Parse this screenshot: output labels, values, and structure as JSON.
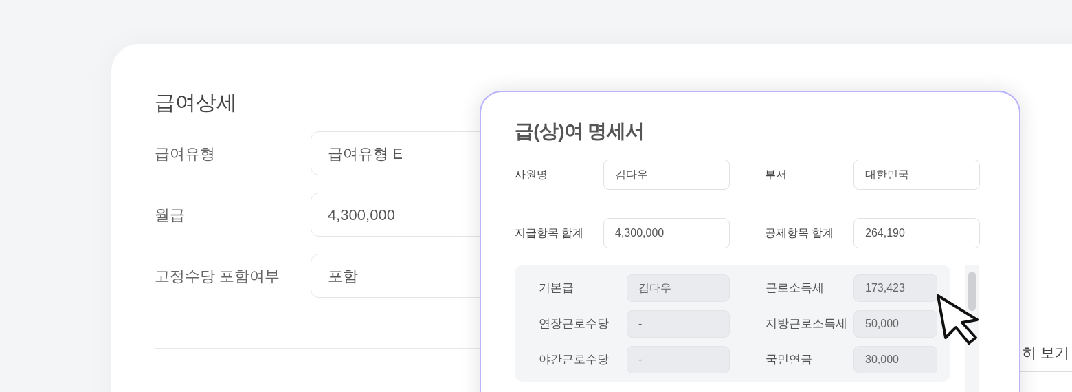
{
  "detail_card": {
    "title": "급여상세",
    "fields": [
      {
        "label": "급여유형",
        "value": "급여유형 E"
      },
      {
        "label": "월급",
        "value": "4,300,000"
      },
      {
        "label": "고정수당 포함여부",
        "value": "포함"
      }
    ],
    "button": "히 보기"
  },
  "payslip": {
    "title": "급(상)여 명세서",
    "header_rows": [
      [
        {
          "label": "사원명",
          "value": "김다우"
        },
        {
          "label": "부서",
          "value": "대한민국"
        }
      ],
      [
        {
          "label": "지급항목 합계",
          "value": "4,300,000"
        },
        {
          "label": "공제항목 합계",
          "value": "264,190"
        }
      ]
    ],
    "items": [
      {
        "earning": {
          "label": "기본급",
          "value": "김다우"
        },
        "deduction": {
          "label": "근로소득세",
          "value": "173,423"
        }
      },
      {
        "earning": {
          "label": "연장근로수당",
          "value": "-"
        },
        "deduction": {
          "label": "지방근로소득세",
          "value": "50,000"
        }
      },
      {
        "earning": {
          "label": "야간근로수당",
          "value": "-"
        },
        "deduction": {
          "label": "국민연금",
          "value": "30,000"
        }
      }
    ]
  }
}
